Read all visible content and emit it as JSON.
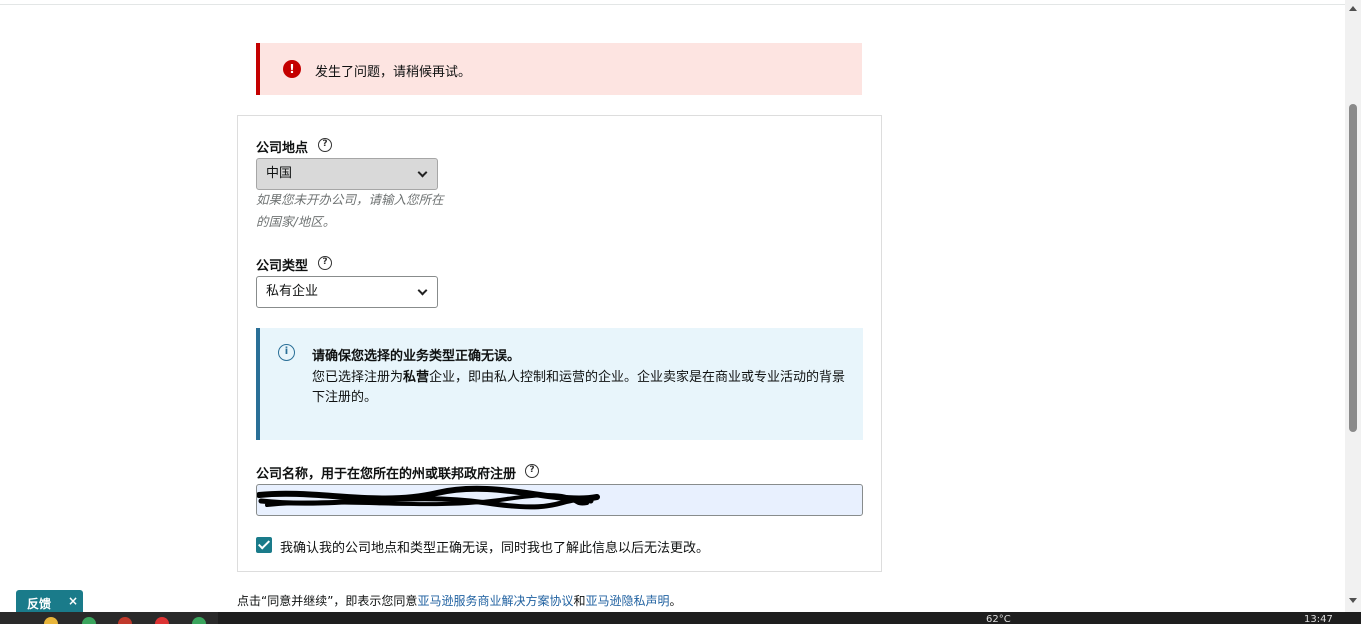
{
  "alert": {
    "message": "发生了问题，请稍候再试。",
    "icon": "error-icon"
  },
  "form": {
    "location_label": "公司地点",
    "location_value": "中国",
    "location_hint": "如果您未开办公司，请输入您所在的国家/地区。",
    "type_label": "公司类型",
    "type_value": "私有企业",
    "info_title": "请确保您选择的业务类型正确无误。",
    "info_body_prefix": "您已选择注册为",
    "info_body_bold": "私营",
    "info_body_suffix": "企业，即由私人控制和运营的企业。企业卖家是在商业或专业活动的背景下注册的。",
    "name_label": "公司名称，用于在您所在的州或联邦政府注册",
    "checkbox_label": "我确认我的公司地点和类型正确无误，同时我也了解此信息以后无法更改。",
    "checkbox_checked": true
  },
  "footer": {
    "prefix": "点击“同意并继续”，即表示您同意",
    "link1": "亚马逊服务商业解决方案协议",
    "middle": "和",
    "link2": "亚马逊隐私声明",
    "suffix": "。"
  },
  "feedback": {
    "label": "反馈",
    "close": "×"
  },
  "taskbar": {
    "temperature": "62°C",
    "time": "13:47"
  },
  "colors": {
    "error": "#c40000",
    "info": "#2a6f97",
    "accent": "#1a7b8a",
    "link": "#2162a1"
  }
}
